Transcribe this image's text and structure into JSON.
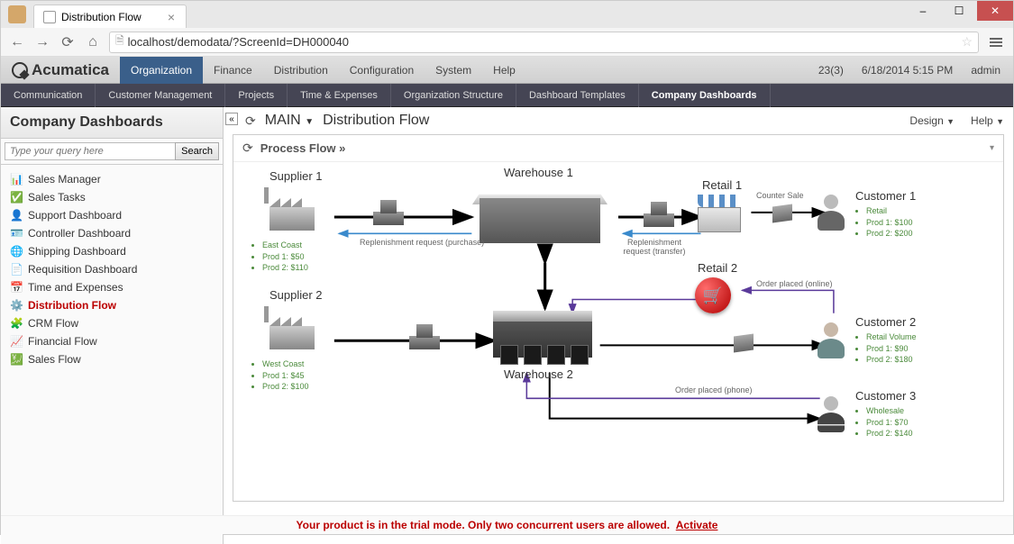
{
  "browser": {
    "tab_title": "Distribution Flow",
    "url": "localhost/demodata/?ScreenId=DH000040"
  },
  "top_nav": {
    "brand": "Acumatica",
    "items": [
      "Organization",
      "Finance",
      "Distribution",
      "Configuration",
      "System",
      "Help"
    ],
    "active": "Organization",
    "status": "23(3)",
    "datetime": "6/18/2014 5:15 PM",
    "user": "admin"
  },
  "sub_nav": {
    "items": [
      "Communication",
      "Customer Management",
      "Projects",
      "Time & Expenses",
      "Organization Structure",
      "Dashboard Templates",
      "Company Dashboards"
    ],
    "active": "Company Dashboards"
  },
  "sidebar": {
    "title": "Company Dashboards",
    "search_placeholder": "Type your query here",
    "search_btn": "Search",
    "items": [
      {
        "label": "Sales Manager",
        "icon": "bars"
      },
      {
        "label": "Sales Tasks",
        "icon": "check"
      },
      {
        "label": "Support Dashboard",
        "icon": "user"
      },
      {
        "label": "Controller Dashboard",
        "icon": "id"
      },
      {
        "label": "Shipping Dashboard",
        "icon": "globe"
      },
      {
        "label": "Requisition Dashboard",
        "icon": "doc"
      },
      {
        "label": "Time and Expenses",
        "icon": "cal"
      },
      {
        "label": "Distribution Flow",
        "icon": "gear",
        "active": true
      },
      {
        "label": "CRM Flow",
        "icon": "puzzle"
      },
      {
        "label": "Financial Flow",
        "icon": "chart"
      },
      {
        "label": "Sales Flow",
        "icon": "sales"
      }
    ]
  },
  "content": {
    "breadcrumb_main": "MAIN",
    "title": "Distribution Flow",
    "design": "Design",
    "help": "Help",
    "panel_title": "Process Flow »"
  },
  "diagram": {
    "supplier1": {
      "label": "Supplier 1",
      "region": "East Coast",
      "lines": [
        "Prod 1: $50",
        "Prod 2: $110"
      ]
    },
    "supplier2": {
      "label": "Supplier 2",
      "region": "West Coast",
      "lines": [
        "Prod 1: $45",
        "Prod 2: $100"
      ]
    },
    "warehouse1": {
      "label": "Warehouse  1"
    },
    "warehouse2": {
      "label": "Warehouse  2"
    },
    "retail1": {
      "label": "Retail 1"
    },
    "retail2": {
      "label": "Retail 2"
    },
    "customer1": {
      "label": "Customer  1",
      "lines": [
        "Retail",
        "Prod 1: $100",
        "Prod 2: $200"
      ]
    },
    "customer2": {
      "label": "Customer  2",
      "lines": [
        "Retail Volume",
        "Prod 1: $90",
        "Prod 2: $180"
      ]
    },
    "customer3": {
      "label": "Customer  3",
      "lines": [
        "Wholesale",
        "Prod 1: $70",
        "Prod 2: $140"
      ]
    },
    "edges": {
      "replen_purchase": "Replenishment  request (purchase)",
      "replen_transfer": "Replenishment request (transfer)",
      "counter_sale": "Counter Sale",
      "order_online": "Order placed (online)",
      "order_phone": "Order placed (phone)"
    }
  },
  "trial": {
    "msg": "Your product is in the trial mode. Only two concurrent users are allowed.",
    "activate": "Activate"
  }
}
